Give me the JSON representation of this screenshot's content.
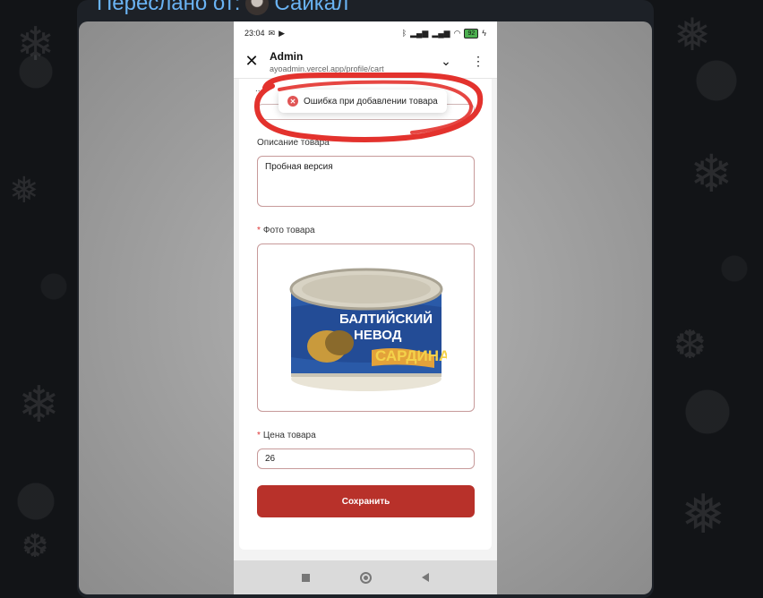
{
  "chat": {
    "forwarded_prefix": "Переслано от:",
    "forwarded_name": "Сайкал"
  },
  "status_bar": {
    "time": "23:04",
    "battery": "92"
  },
  "browser": {
    "title": "Admin",
    "url": "ayoadmin.vercel.app/profile/cart",
    "close_icon": "close-icon",
    "chevron_icon": "chevron-down-icon",
    "menu_icon": "more-vertical-icon"
  },
  "form": {
    "ellipsis": "...",
    "toast_message": "Ошибка при добавлении товара",
    "description_label": "Описание товара",
    "description_value": "Пробная версия",
    "photo_label": "Фото товара",
    "photo_label_required": "*",
    "product_image_text_line1": "БАЛТИЙСКИЙ",
    "product_image_text_line2": "НЕВОД",
    "product_image_text_line3": "САРДИНА",
    "price_label": "Цена товара",
    "price_label_required": "*",
    "price_value": "26",
    "save_label": "Сохранить"
  },
  "colors": {
    "accent": "#b8312a",
    "error": "#e05555",
    "annotation": "#e3322d",
    "link": "#6ab3f3"
  }
}
